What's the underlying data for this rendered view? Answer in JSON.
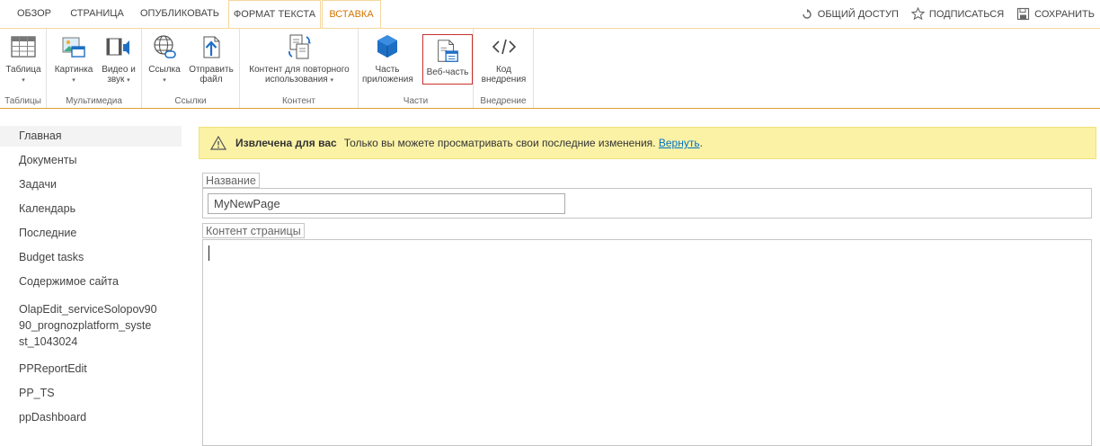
{
  "tabs": [
    {
      "label": "ОБЗОР"
    },
    {
      "label": "СТРАНИЦА"
    },
    {
      "label": "ОПУБЛИКОВАТЬ"
    },
    {
      "label": "ФОРМАТ ТЕКСТА"
    },
    {
      "label": "ВСТАВКА"
    }
  ],
  "actions": {
    "share": "ОБЩИЙ ДОСТУП",
    "follow": "ПОДПИСАТЬСЯ",
    "save": "СОХРАНИТЬ"
  },
  "ribbon": {
    "groups": {
      "tables": "Таблицы",
      "media": "Мультимедиа",
      "links": "Ссылки",
      "content": "Контент",
      "parts": "Части",
      "embed": "Внедрение"
    },
    "buttons": {
      "table": "Таблица",
      "picture": "Картинка",
      "video_line1": "Видео и",
      "video_line2": "звук",
      "link": "Ссылка",
      "upload_line1": "Отправить",
      "upload_line2": "файл",
      "reusable_line1": "Контент для повторного",
      "reusable_line2": "использования",
      "app_part_line1": "Часть",
      "app_part_line2": "приложения",
      "web_part": "Веб-часть",
      "embed_line1": "Код",
      "embed_line2": "внедрения"
    }
  },
  "nav": [
    {
      "label": "Главная"
    },
    {
      "label": "Документы"
    },
    {
      "label": "Задачи"
    },
    {
      "label": "Календарь"
    },
    {
      "label": "Последние"
    },
    {
      "label": "Budget tasks"
    },
    {
      "label": "Содержимое сайта"
    },
    {
      "label_1": "OlapEdit_serviceSolopov90",
      "label_2": "90_prognozplatform_syste",
      "label_3": "st_1043024"
    },
    {
      "label": "PPReportEdit"
    },
    {
      "label": "PP_TS"
    },
    {
      "label": "ppDashboard"
    }
  ],
  "status": {
    "bold": "Извлечена для вас",
    "text": "Только вы можете просматривать свои последние изменения.",
    "link": "Вернуть",
    "tail": "."
  },
  "form": {
    "title_label": "Название",
    "title_value": "MyNewPage",
    "content_label": "Контент страницы"
  },
  "colors": {
    "accent_tab": "#d47500",
    "status_bg": "#fbf2a6",
    "link": "#0072c6",
    "selected_border": "#c9302c"
  }
}
